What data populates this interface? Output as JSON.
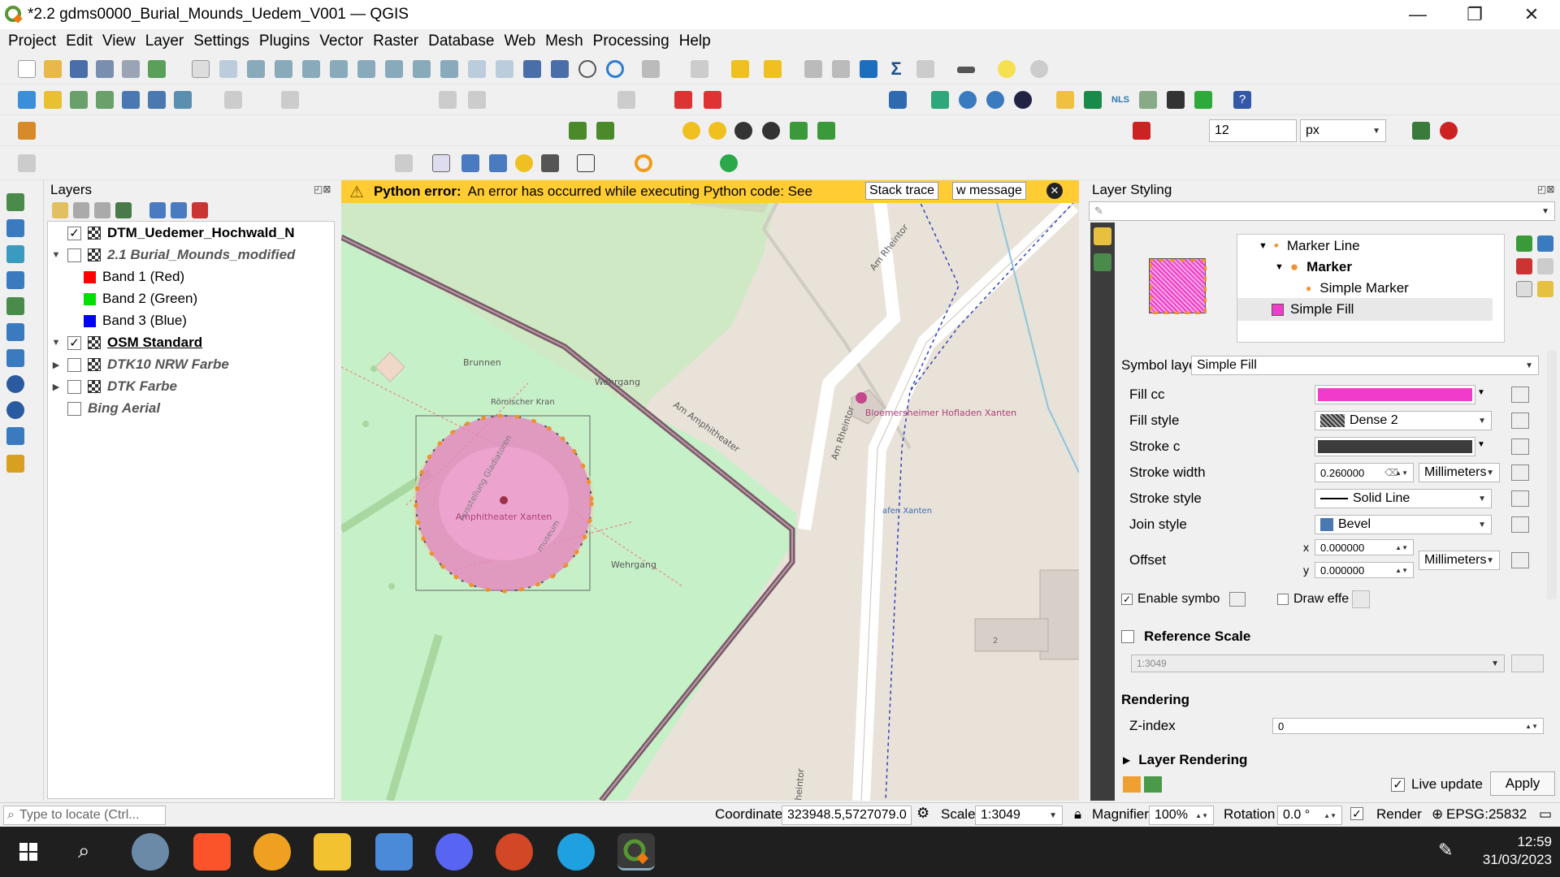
{
  "window": {
    "title": "*2.2 gdms0000_Burial_Mounds_Uedem_V001 — QGIS",
    "minimize": "—",
    "restore": "❐",
    "close": "✕"
  },
  "menu": [
    "Project",
    "Edit",
    "View",
    "Layer",
    "Settings",
    "Plugins",
    "Vector",
    "Raster",
    "Database",
    "Web",
    "Mesh",
    "Processing",
    "Help"
  ],
  "toolbar": {
    "size_value": "12",
    "unit_value": "px"
  },
  "layers_panel": {
    "title": "Layers",
    "items": [
      {
        "label": "DTM_Uedemer_Hochwald_N",
        "checked": true
      },
      {
        "label": "2.1 Burial_Mounds_modified",
        "checked": false
      },
      {
        "label": "Band 1 (Red)",
        "color": "#ff0000"
      },
      {
        "label": "Band 2 (Green)",
        "color": "#00e000"
      },
      {
        "label": "Band 3 (Blue)",
        "color": "#0000ff"
      },
      {
        "label": "OSM Standard",
        "checked": true
      },
      {
        "label": "DTK10 NRW Farbe",
        "checked": false
      },
      {
        "label": "DTK Farbe",
        "checked": false
      },
      {
        "label": "Bing Aerial",
        "checked": false
      }
    ]
  },
  "error_bar": {
    "bold": "Python error:",
    "message": "An error has occurred while executing Python code: See",
    "stack_trace": "Stack trace",
    "view_message": "w message"
  },
  "map_labels": {
    "brunnen": "Brunnen",
    "wehrgang1": "Wehrgang",
    "wehrgang2": "Wehrgang",
    "kran": "Römischer Kran",
    "am_amphitheater": "Am Amphitheater",
    "am_rheintor1": "Am Rheintor",
    "am_rheintor2": "Am Rheintor",
    "rheintor_bottom": "heintor",
    "hofladen": "Bloemersheimer Hofladen Xanten",
    "amphitheater": "Amphitheater Xanten",
    "gladiatoren": "Ausstellung Gladiatoren",
    "museum": "museum",
    "hafen": "afen Xanten",
    "house_no": "2"
  },
  "styling": {
    "title": "Layer Styling",
    "tree": {
      "marker_line": "Marker Line",
      "marker": "Marker",
      "simple_marker": "Simple Marker",
      "simple_fill": "Simple Fill"
    },
    "symbol_layer_label": "Symbol laye",
    "symbol_layer_value": "Simple Fill",
    "fill_color_label": "Fill cc",
    "fill_color": "#f03cc8",
    "fill_style_label": "Fill style",
    "fill_style_value": "Dense 2",
    "stroke_color_label": "Stroke c",
    "stroke_color": "#3c3c3c",
    "stroke_width_label": "Stroke width",
    "stroke_width_value": "0.260000",
    "stroke_width_unit": "Millimeters",
    "stroke_style_label": "Stroke style",
    "stroke_style_value": "Solid Line",
    "join_style_label": "Join style",
    "join_style_value": "Bevel",
    "offset_label": "Offset",
    "offset_x_label": "x",
    "offset_x": "0.000000",
    "offset_y_label": "y",
    "offset_y": "0.000000",
    "offset_unit": "Millimeters",
    "enable_symbol": "Enable symbo",
    "draw_effects": "Draw effe",
    "reference_scale": "Reference Scale",
    "reference_scale_value": "1:3049",
    "rendering": "Rendering",
    "zindex_label": "Z-index",
    "zindex_value": "0",
    "layer_rendering": "Layer Rendering",
    "live_update": "Live update",
    "apply": "Apply"
  },
  "statusbar": {
    "locate_placeholder": "Type to locate (Ctrl...",
    "coordinate_label": "Coordinate",
    "coordinate_value": "323948.5,5727079.0",
    "scale_label": "Scale",
    "scale_value": "1:3049",
    "magnifier_label": "Magnifier",
    "magnifier_value": "100%",
    "rotation_label": "Rotation",
    "rotation_value": "0.0 °",
    "render_label": "Render",
    "crs": "EPSG:25832"
  },
  "taskbar": {
    "time": "12:59",
    "date": "31/03/2023"
  }
}
